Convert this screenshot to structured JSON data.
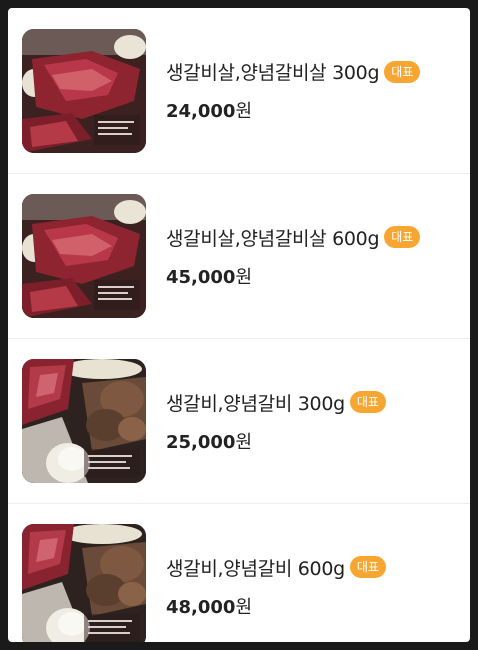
{
  "menu": {
    "items": [
      {
        "name": "생갈비살,양념갈비살 300g",
        "badge": "대표",
        "price": "24,000",
        "unit": "원",
        "image": "marinated-galbi-sal"
      },
      {
        "name": "생갈비살,양념갈비살 600g",
        "badge": "대표",
        "price": "45,000",
        "unit": "원",
        "image": "marinated-galbi-sal"
      },
      {
        "name": "생갈비,양념갈비 300g",
        "badge": "대표",
        "price": "25,000",
        "unit": "원",
        "image": "raw-and-marinated-galbi"
      },
      {
        "name": "생갈비,양념갈비 600g",
        "badge": "대표",
        "price": "48,000",
        "unit": "원",
        "image": "raw-and-marinated-galbi"
      }
    ]
  },
  "colors": {
    "badge": "#f7a632",
    "text": "#222222",
    "divider": "#eeeeee"
  }
}
